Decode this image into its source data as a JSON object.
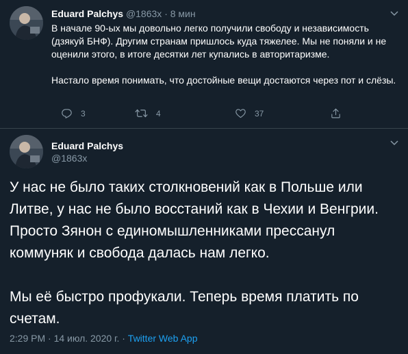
{
  "tweet1": {
    "author_name": "Eduard Palchys",
    "handle": "@1863x",
    "separator": "·",
    "time": "8 мин",
    "paragraphs": [
      "В начале 90-ых мы довольно легко получили свободу и независимость (дзякуй БНФ). Другим странам пришлось куда тяжелее. Мы не поняли и не оценили этого, в итоге десятки лет купались в авторитаризме.",
      "Настало время понимать, что достойные вещи достаются через пот и слёзы."
    ],
    "actions": {
      "reply_count": "3",
      "retweet_count": "4",
      "like_count": "37"
    }
  },
  "tweet2": {
    "author_name": "Eduard Palchys",
    "handle": "@1863x",
    "paragraphs": [
      "У нас не было таких столкновений как в Польше или Литве, у нас не было восстаний как в Чехии и Венгрии. Просто Зянон с единомышленниками прессанул коммуняк и свобода далась нам легко.",
      "Мы её быстро профукали. Теперь время платить по счетам."
    ],
    "time": "2:29 PM",
    "date": "14 июл. 2020 г.",
    "separator": "·",
    "source": "Twitter Web App"
  },
  "colors": {
    "background": "#15202b",
    "muted": "#8899a6",
    "link": "#1da1f2",
    "divider": "#38444d"
  },
  "icons": [
    "avatar-photo",
    "chevron-down-icon",
    "reply-icon",
    "retweet-icon",
    "like-icon",
    "share-icon"
  ]
}
